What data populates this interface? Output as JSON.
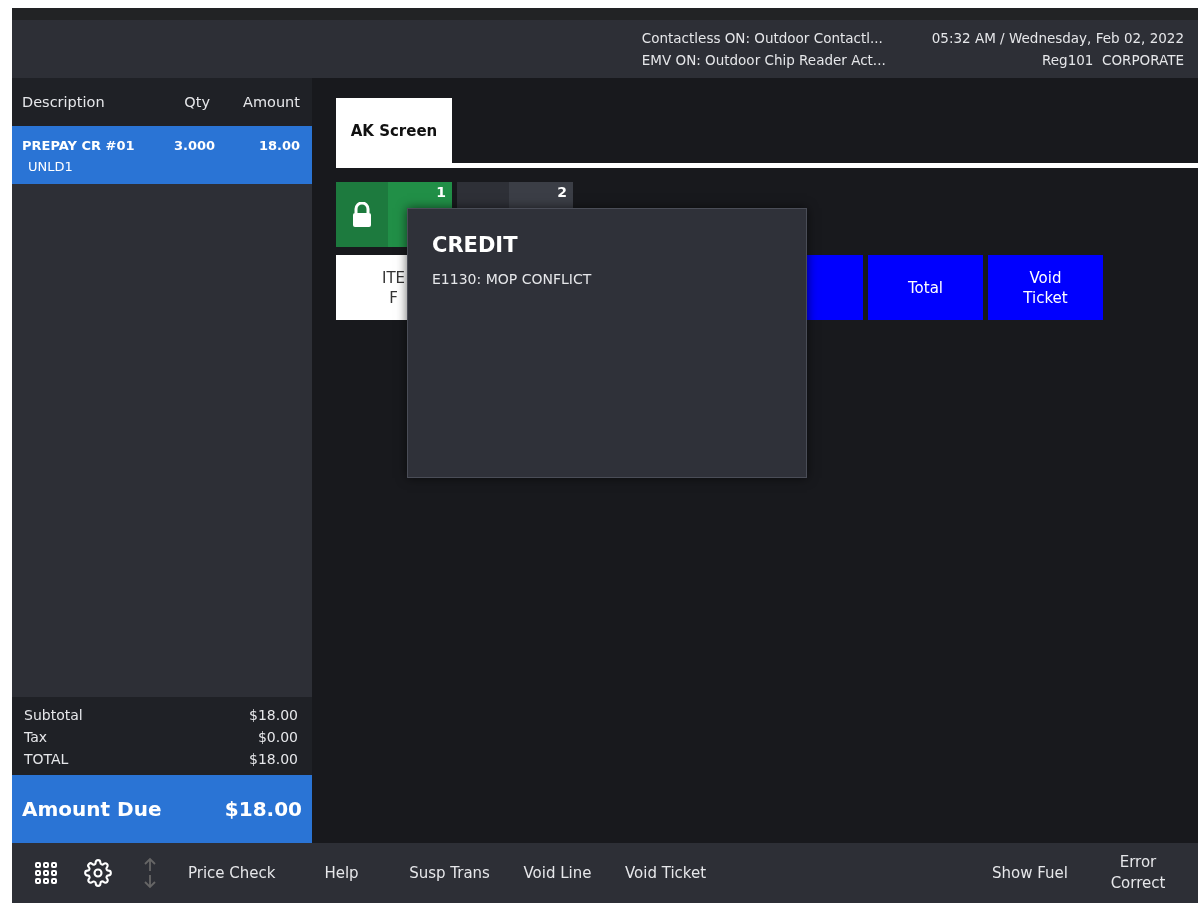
{
  "header": {
    "status_lines": [
      "Contactless ON: Outdoor Contactl...",
      "EMV ON: Outdoor Chip Reader Act..."
    ],
    "datetime": "05:32 AM / Wednesday, Feb 02, 2022",
    "register": "Reg101",
    "user": "CORPORATE"
  },
  "ticket": {
    "columns": [
      "Description",
      "Qty",
      "Amount"
    ],
    "rows": [
      {
        "description": "PREPAY CR #01",
        "sub": "UNLD1",
        "qty": "3.000",
        "amount": "18.00",
        "selected": true
      }
    ],
    "totals": [
      {
        "label": "Subtotal",
        "value": "$18.00"
      },
      {
        "label": "Tax",
        "value": "$0.00"
      },
      {
        "label": "TOTAL",
        "value": "$18.00"
      }
    ],
    "amount_due": {
      "label": "Amount Due",
      "value": "$18.00"
    }
  },
  "tabs": [
    {
      "label": "AK Screen",
      "selected": true
    }
  ],
  "pumps": [
    {
      "number": "1",
      "kind": "locked"
    },
    {
      "number": "2",
      "kind": "idle"
    }
  ],
  "buttons": [
    {
      "lines": [
        "ITE",
        "F"
      ],
      "kind": "white"
    },
    {
      "kind": "blue"
    },
    {
      "lines": [
        "Total"
      ],
      "kind": "blue"
    },
    {
      "lines": [
        "Void",
        "Ticket"
      ],
      "kind": "blue"
    }
  ],
  "dialog": {
    "title": "CREDIT",
    "message": "E1130: MOP CONFLICT"
  },
  "footer": {
    "items": [
      {
        "kind": "grid"
      },
      {
        "kind": "gear"
      },
      {
        "kind": "arrows"
      },
      {
        "kind": "text",
        "lines": [
          "Price Check"
        ]
      },
      {
        "kind": "text",
        "lines": [
          "Help"
        ]
      },
      {
        "kind": "text",
        "lines": [
          "Susp Trans"
        ]
      },
      {
        "kind": "text",
        "lines": [
          "Void Line"
        ]
      },
      {
        "kind": "text",
        "lines": [
          "Void Ticket"
        ]
      },
      {
        "kind": "spacer"
      },
      {
        "kind": "text",
        "lines": [
          "Show Fuel"
        ]
      },
      {
        "kind": "text",
        "lines": [
          "Error",
          "Correct"
        ]
      }
    ]
  }
}
